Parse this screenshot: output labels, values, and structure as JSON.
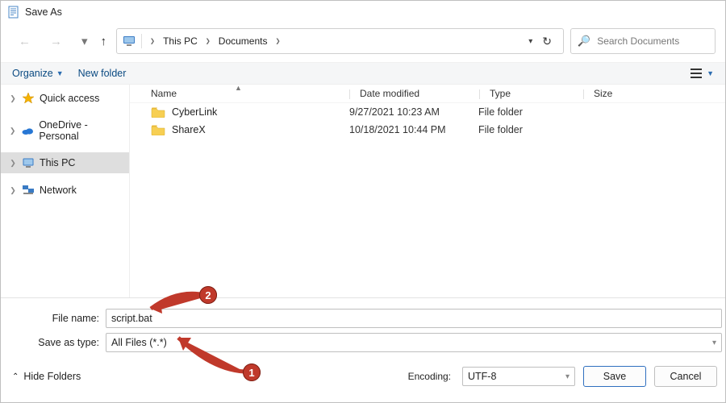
{
  "title": "Save As",
  "nav": {
    "back_enabled": false,
    "forward_enabled": false,
    "recent_enabled": true,
    "up_enabled": true
  },
  "breadcrumb": {
    "items": [
      "This PC",
      "Documents"
    ]
  },
  "search": {
    "placeholder": "Search Documents"
  },
  "toolbar": {
    "organize": "Organize",
    "new_folder": "New folder"
  },
  "sidebar": {
    "items": [
      {
        "label": "Quick access",
        "icon": "star"
      },
      {
        "label": "OneDrive - Personal",
        "icon": "cloud"
      },
      {
        "label": "This PC",
        "icon": "monitor",
        "selected": true
      },
      {
        "label": "Network",
        "icon": "network"
      }
    ]
  },
  "columns": {
    "name": "Name",
    "date": "Date modified",
    "type": "Type",
    "size": "Size"
  },
  "rows": [
    {
      "name": "CyberLink",
      "date": "9/27/2021 10:23 AM",
      "type": "File folder"
    },
    {
      "name": "ShareX",
      "date": "10/18/2021 10:44 PM",
      "type": "File folder"
    }
  ],
  "form": {
    "file_name_label": "File name:",
    "file_name_value": "script.bat",
    "save_type_label": "Save as type:",
    "save_type_value": "All Files  (*.*)"
  },
  "bottom": {
    "hide_folders": "Hide Folders",
    "encoding_label": "Encoding:",
    "encoding_value": "UTF-8",
    "save": "Save",
    "cancel": "Cancel"
  },
  "annotations": {
    "one": "1",
    "two": "2"
  }
}
